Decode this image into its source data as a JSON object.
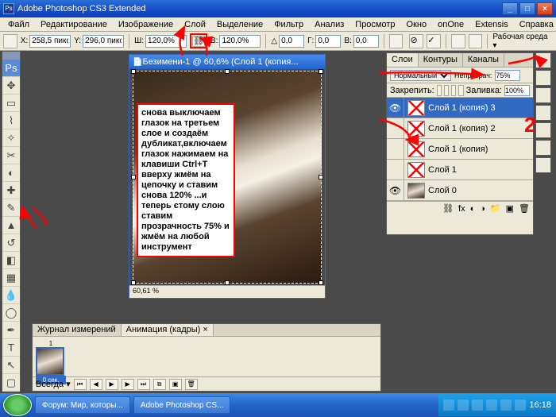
{
  "title": "Adobe Photoshop CS3 Extended",
  "menu": [
    "Файл",
    "Редактирование",
    "Изображение",
    "Слой",
    "Выделение",
    "Фильтр",
    "Анализ",
    "Просмотр",
    "Окно",
    "onOne",
    "Extensis",
    "Справка"
  ],
  "options": {
    "x_label": "X:",
    "x_val": "258,5 пикс",
    "y_label": "Y:",
    "y_val": "296,0 пикс",
    "w_label": "Ш:",
    "w_val": "120,0%",
    "h_label": "В:",
    "h_val": "120,0%",
    "a_label": "△",
    "a_val": "0,0",
    "hskew_label": "Г:",
    "hskew_val": "0,0",
    "vskew_label": "В:",
    "vskew_val": "0,0",
    "workspace": "Рабочая среда ▾"
  },
  "doc": {
    "title": "Безимени-1 @ 60,6% (Слой 1 (копия...",
    "zoom": "60,61 %"
  },
  "note_text": "снова выключаем глазок на третьем слое и создаём дубликат,включаем глазок нажимаем на клавиши  Ctrl+T вверху жмём на цепочку и ставим снова 120% ...и теперь єтому слою ставим прозрачность 75% и жмём на любой инструмент",
  "layers_panel": {
    "tabs": [
      "Слои",
      "Контуры",
      "Каналы"
    ],
    "blend": "Нормальный",
    "opacity_label": "Непрозрач:",
    "opacity": "75%",
    "lock_label": "Закрепить:",
    "fill_label": "Заливка:",
    "fill": "100%",
    "items": [
      {
        "name": "Слой 1 (копия) 3",
        "sel": true,
        "vis": true,
        "thumb": "x"
      },
      {
        "name": "Слой 1 (копия) 2",
        "sel": false,
        "vis": false,
        "thumb": "x"
      },
      {
        "name": "Слой 1 (копия)",
        "sel": false,
        "vis": false,
        "thumb": "x"
      },
      {
        "name": "Слой 1",
        "sel": false,
        "vis": false,
        "thumb": "x"
      },
      {
        "name": "Слой 0",
        "sel": false,
        "vis": true,
        "thumb": "im"
      }
    ]
  },
  "anim": {
    "tabs": [
      "Журнал измерений",
      "Анимация (кадры) ×"
    ],
    "frame1": "1",
    "frame1_time": "0 сек.",
    "loop": "Всегда ▾"
  },
  "taskbar": {
    "btn1": "Форум: Мир, которы...",
    "btn2": "Adobe Photoshop CS...",
    "clock": "16:18"
  }
}
